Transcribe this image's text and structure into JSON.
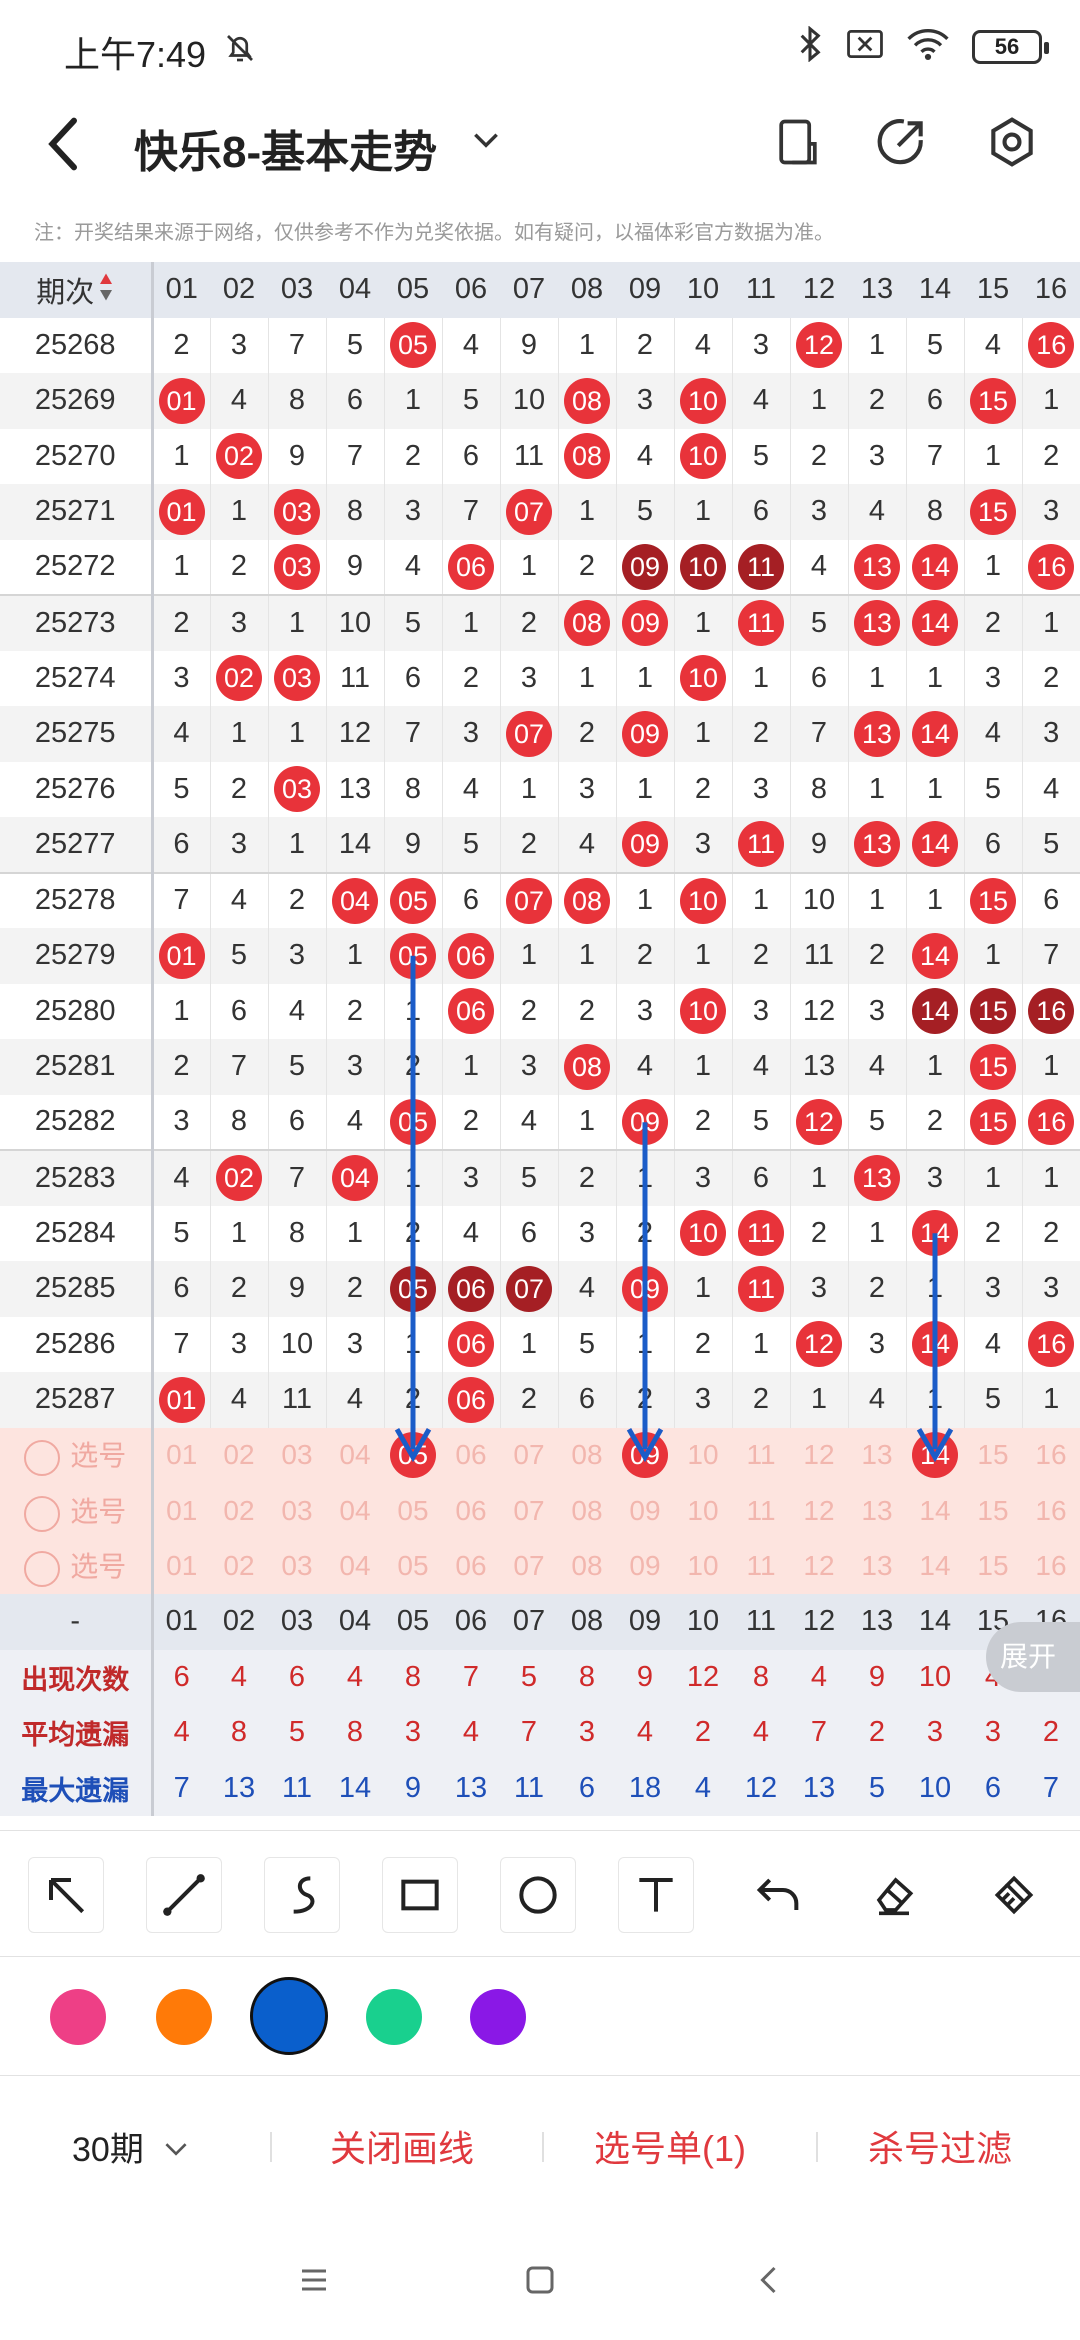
{
  "status": {
    "time": "上午7:49",
    "battery": "56"
  },
  "header": {
    "title": "快乐8-基本走势"
  },
  "notice": "注：开奖结果来源于网络，仅供参考不作为兑奖依据。如有疑问，以福体彩官方数据为准。",
  "table": {
    "period_header": "期次",
    "columns": [
      "01",
      "02",
      "03",
      "04",
      "05",
      "06",
      "07",
      "08",
      "09",
      "10",
      "11",
      "12",
      "13",
      "14",
      "15",
      "16"
    ],
    "rows": [
      {
        "period": "25268",
        "cells": [
          "2",
          "3",
          "7",
          "5",
          "05",
          "4",
          "9",
          "1",
          "2",
          "4",
          "3",
          "12",
          "1",
          "5",
          "4",
          "16"
        ],
        "balls": [
          4,
          11,
          15
        ]
      },
      {
        "period": "25269",
        "cells": [
          "01",
          "4",
          "8",
          "6",
          "1",
          "5",
          "10",
          "08",
          "3",
          "10",
          "4",
          "1",
          "2",
          "6",
          "15",
          "1"
        ],
        "balls": [
          0,
          7,
          9,
          14
        ]
      },
      {
        "period": "25270",
        "cells": [
          "1",
          "02",
          "9",
          "7",
          "2",
          "6",
          "11",
          "08",
          "4",
          "10",
          "5",
          "2",
          "3",
          "7",
          "1",
          "2"
        ],
        "balls": [
          1,
          7,
          9
        ]
      },
      {
        "period": "25271",
        "cells": [
          "01",
          "1",
          "03",
          "8",
          "3",
          "7",
          "07",
          "1",
          "5",
          "1",
          "6",
          "3",
          "4",
          "8",
          "15",
          "3"
        ],
        "balls": [
          0,
          2,
          6,
          14
        ]
      },
      {
        "period": "25272",
        "cells": [
          "1",
          "2",
          "03",
          "9",
          "4",
          "06",
          "1",
          "2",
          "09",
          "10",
          "11",
          "4",
          "13",
          "14",
          "1",
          "16"
        ],
        "balls": [
          2,
          5,
          8,
          9,
          10,
          12,
          13,
          15
        ],
        "dark": [
          8,
          9,
          10
        ]
      },
      {
        "period": "25273",
        "cells": [
          "2",
          "3",
          "1",
          "10",
          "5",
          "1",
          "2",
          "08",
          "09",
          "1",
          "11",
          "5",
          "13",
          "14",
          "2",
          "1"
        ],
        "balls": [
          7,
          8,
          10,
          12,
          13
        ]
      },
      {
        "period": "25274",
        "cells": [
          "3",
          "02",
          "03",
          "11",
          "6",
          "2",
          "3",
          "1",
          "1",
          "10",
          "1",
          "6",
          "1",
          "1",
          "3",
          "2"
        ],
        "balls": [
          1,
          2,
          9
        ]
      },
      {
        "period": "25275",
        "cells": [
          "4",
          "1",
          "1",
          "12",
          "7",
          "3",
          "07",
          "2",
          "09",
          "1",
          "2",
          "7",
          "13",
          "14",
          "4",
          "3"
        ],
        "balls": [
          6,
          8,
          12,
          13
        ]
      },
      {
        "period": "25276",
        "cells": [
          "5",
          "2",
          "03",
          "13",
          "8",
          "4",
          "1",
          "3",
          "1",
          "2",
          "3",
          "8",
          "1",
          "1",
          "5",
          "4"
        ],
        "balls": [
          2
        ]
      },
      {
        "period": "25277",
        "cells": [
          "6",
          "3",
          "1",
          "14",
          "9",
          "5",
          "2",
          "4",
          "09",
          "3",
          "11",
          "9",
          "13",
          "14",
          "6",
          "5"
        ],
        "balls": [
          8,
          10,
          12,
          13
        ]
      },
      {
        "period": "25278",
        "cells": [
          "7",
          "4",
          "2",
          "04",
          "05",
          "6",
          "07",
          "08",
          "1",
          "10",
          "1",
          "10",
          "1",
          "1",
          "15",
          "6"
        ],
        "balls": [
          3,
          4,
          6,
          7,
          9,
          14
        ]
      },
      {
        "period": "25279",
        "cells": [
          "01",
          "5",
          "3",
          "1",
          "05",
          "06",
          "1",
          "1",
          "2",
          "1",
          "2",
          "11",
          "2",
          "14",
          "1",
          "7"
        ],
        "balls": [
          0,
          4,
          5,
          13
        ]
      },
      {
        "period": "25280",
        "cells": [
          "1",
          "6",
          "4",
          "2",
          "1",
          "06",
          "2",
          "2",
          "3",
          "10",
          "3",
          "12",
          "3",
          "14",
          "15",
          "16"
        ],
        "balls": [
          5,
          9,
          13,
          14,
          15
        ],
        "dark": [
          13,
          14,
          15
        ]
      },
      {
        "period": "25281",
        "cells": [
          "2",
          "7",
          "5",
          "3",
          "2",
          "1",
          "3",
          "08",
          "4",
          "1",
          "4",
          "13",
          "4",
          "1",
          "15",
          "1"
        ],
        "balls": [
          7,
          14
        ]
      },
      {
        "period": "25282",
        "cells": [
          "3",
          "8",
          "6",
          "4",
          "05",
          "2",
          "4",
          "1",
          "09",
          "2",
          "5",
          "12",
          "5",
          "2",
          "15",
          "16"
        ],
        "balls": [
          4,
          8,
          11,
          14,
          15
        ]
      },
      {
        "period": "25283",
        "cells": [
          "4",
          "02",
          "7",
          "04",
          "1",
          "3",
          "5",
          "2",
          "1",
          "3",
          "6",
          "1",
          "13",
          "3",
          "1",
          "1"
        ],
        "balls": [
          1,
          3,
          12
        ]
      },
      {
        "period": "25284",
        "cells": [
          "5",
          "1",
          "8",
          "1",
          "2",
          "4",
          "6",
          "3",
          "2",
          "10",
          "11",
          "2",
          "1",
          "14",
          "2",
          "2"
        ],
        "balls": [
          9,
          10,
          13
        ]
      },
      {
        "period": "25285",
        "cells": [
          "6",
          "2",
          "9",
          "2",
          "05",
          "06",
          "07",
          "4",
          "09",
          "1",
          "11",
          "3",
          "2",
          "1",
          "3",
          "3"
        ],
        "balls": [
          4,
          5,
          6,
          8,
          10
        ],
        "dark": [
          4,
          5,
          6
        ]
      },
      {
        "period": "25286",
        "cells": [
          "7",
          "3",
          "10",
          "3",
          "1",
          "06",
          "1",
          "5",
          "1",
          "2",
          "1",
          "12",
          "3",
          "14",
          "4",
          "16"
        ],
        "balls": [
          5,
          11,
          13,
          15
        ]
      },
      {
        "period": "25287",
        "cells": [
          "01",
          "4",
          "11",
          "4",
          "2",
          "06",
          "2",
          "6",
          "2",
          "3",
          "2",
          "1",
          "4",
          "1",
          "5",
          "1"
        ],
        "balls": [
          0,
          5
        ]
      }
    ],
    "pick_label": "选号",
    "pick_rows": [
      {
        "ball_cols": [
          4,
          8,
          13
        ]
      },
      {
        "ball_cols": []
      },
      {
        "ball_cols": []
      }
    ],
    "footer_dash": "-",
    "stats": [
      {
        "label": "出现次数",
        "values": [
          "6",
          "4",
          "6",
          "4",
          "8",
          "7",
          "5",
          "8",
          "9",
          "12",
          "8",
          "4",
          "9",
          "10",
          "4",
          "6"
        ],
        "tone": "red"
      },
      {
        "label": "平均遗漏",
        "values": [
          "4",
          "8",
          "5",
          "8",
          "3",
          "4",
          "7",
          "3",
          "4",
          "2",
          "4",
          "7",
          "2",
          "3",
          "3",
          "2"
        ],
        "tone": "red"
      },
      {
        "label": "最大遗漏",
        "values": [
          "7",
          "13",
          "11",
          "14",
          "9",
          "13",
          "11",
          "6",
          "18",
          "4",
          "12",
          "13",
          "5",
          "10",
          "6",
          "7"
        ],
        "tone": "blue"
      }
    ]
  },
  "expand_label": "展开",
  "palette": {
    "colors": [
      "#ee3f86",
      "#ff7a08",
      "#0a5fcc",
      "#19d08e",
      "#8a18e6"
    ],
    "selected": "#0a5fcc"
  },
  "arrow_color": "#1b5cc8",
  "actions": {
    "period": "30期",
    "close_lines": "关闭画线",
    "pick_list": "选号单(1)",
    "kill_filter": "杀号过滤"
  }
}
